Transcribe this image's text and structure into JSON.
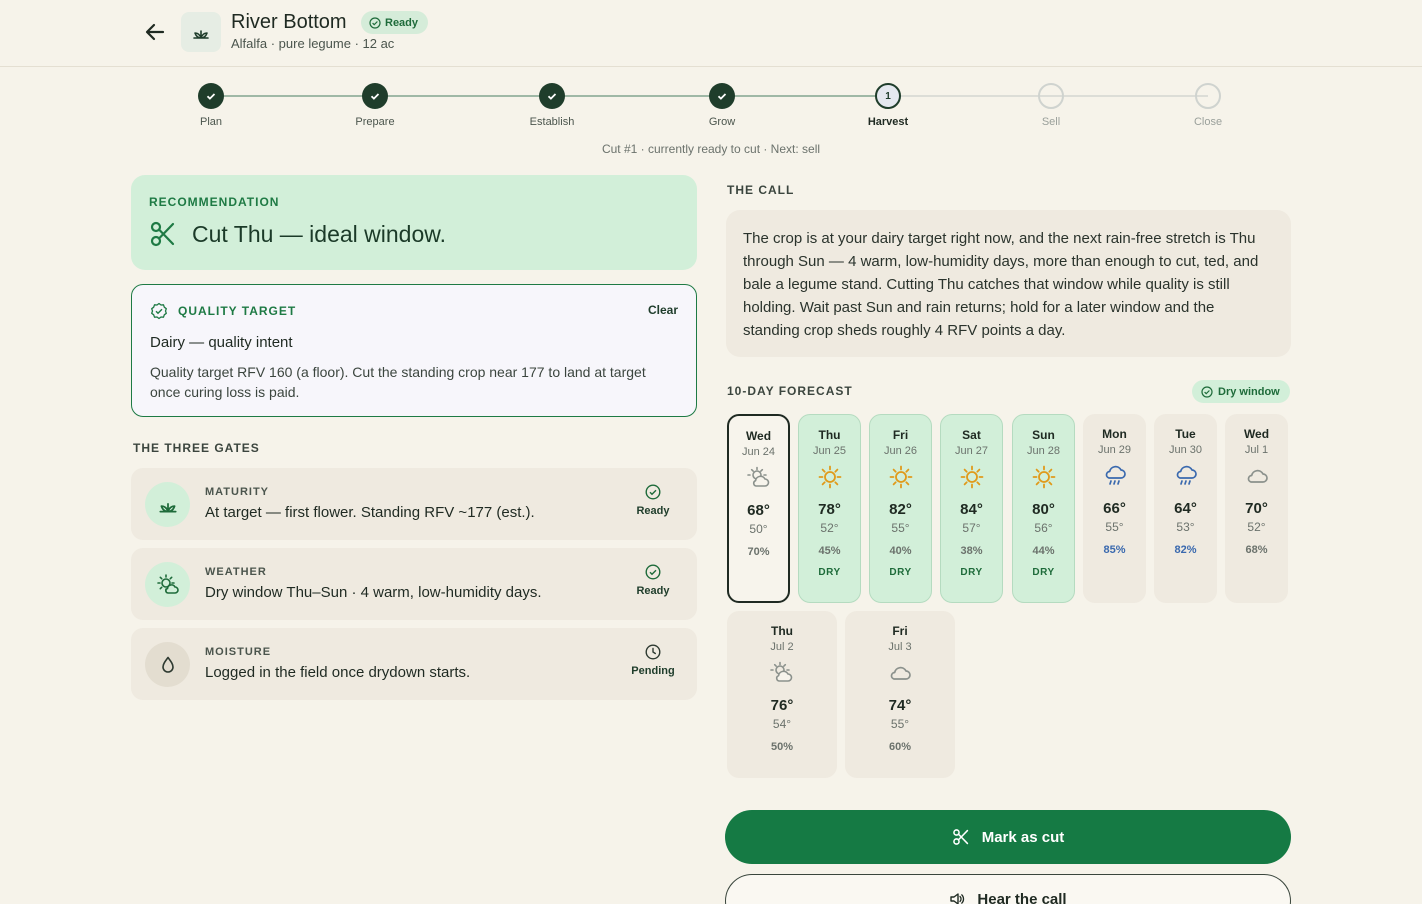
{
  "header": {
    "back_label": "Back",
    "field_name": "River Bottom",
    "status": "Ready",
    "subtitle": "Alfalfa · pure legume · 12 ac"
  },
  "stepper": {
    "steps": [
      {
        "label": "Plan",
        "state": "done"
      },
      {
        "label": "Prepare",
        "state": "done"
      },
      {
        "label": "Establish",
        "state": "done"
      },
      {
        "label": "Grow",
        "state": "done"
      },
      {
        "label": "Harvest",
        "state": "current",
        "number": "1"
      },
      {
        "label": "Sell",
        "state": "todo"
      },
      {
        "label": "Close",
        "state": "todo"
      }
    ],
    "note": "Cut #1 · currently ready to cut · Next: sell"
  },
  "recommendation": {
    "eyebrow": "RECOMMENDATION",
    "title": "Cut Thu — ideal window."
  },
  "quality_target": {
    "eyebrow": "QUALITY TARGET",
    "clear_label": "Clear",
    "title": "Dairy — quality intent",
    "body": "Quality target RFV 160 (a floor). Cut the standing crop near 177 to land at target once curing loss is paid."
  },
  "gates": {
    "heading": "THE THREE GATES",
    "items": [
      {
        "eyebrow": "MATURITY",
        "text": "At target — first flower. Standing RFV ~177 (est.).",
        "status": "Ready",
        "icon": "sprout-icon",
        "status_icon": "check-circle-icon"
      },
      {
        "eyebrow": "WEATHER",
        "text": "Dry window Thu–Sun · 4 warm, low-humidity days.",
        "status": "Ready",
        "icon": "sun-cloud-icon",
        "status_icon": "check-circle-icon"
      },
      {
        "eyebrow": "MOISTURE",
        "text": "Logged in the field once drydown starts.",
        "status": "Pending",
        "icon": "droplet-icon",
        "status_icon": "clock-icon"
      }
    ]
  },
  "the_call": {
    "heading": "THE CALL",
    "body": "The crop is at your dairy target right now, and the next rain-free stretch is Thu through Sun — 4 warm, low-humidity days, more than enough to cut, ted, and bale a legume stand. Cutting Thu catches that window while quality is still holding. Wait past Sun and rain returns; hold for a later window and the standing crop sheds roughly 4 RFV points a day."
  },
  "forecast": {
    "heading": "10-DAY FORECAST",
    "badge": "Dry window",
    "days": [
      {
        "day": "Wed",
        "date": "Jun 24",
        "icon": "partly-cloudy-icon",
        "hi": "68°",
        "lo": "50°",
        "pop": "70%",
        "tag": "",
        "style": "today"
      },
      {
        "day": "Thu",
        "date": "Jun 25",
        "icon": "sun-icon",
        "hi": "78°",
        "lo": "52°",
        "pop": "45%",
        "tag": "DRY",
        "style": "dry"
      },
      {
        "day": "Fri",
        "date": "Jun 26",
        "icon": "sun-icon",
        "hi": "82°",
        "lo": "55°",
        "pop": "40%",
        "tag": "DRY",
        "style": "dry"
      },
      {
        "day": "Sat",
        "date": "Jun 27",
        "icon": "sun-icon",
        "hi": "84°",
        "lo": "57°",
        "pop": "38%",
        "tag": "DRY",
        "style": "dry"
      },
      {
        "day": "Sun",
        "date": "Jun 28",
        "icon": "sun-icon",
        "hi": "80°",
        "lo": "56°",
        "pop": "44%",
        "tag": "DRY",
        "style": "dry"
      },
      {
        "day": "Mon",
        "date": "Jun 29",
        "icon": "rain-icon",
        "hi": "66°",
        "lo": "55°",
        "pop": "85%",
        "tag": "",
        "style": "wet"
      },
      {
        "day": "Tue",
        "date": "Jun 30",
        "icon": "rain-icon",
        "hi": "64°",
        "lo": "53°",
        "pop": "82%",
        "tag": "",
        "style": "wet"
      },
      {
        "day": "Wed",
        "date": "Jul 1",
        "icon": "cloud-icon",
        "hi": "70°",
        "lo": "52°",
        "pop": "68%",
        "tag": "",
        "style": "plain"
      },
      {
        "day": "Thu",
        "date": "Jul 2",
        "icon": "partly-cloudy-icon",
        "hi": "76°",
        "lo": "54°",
        "pop": "50%",
        "tag": "",
        "style": "plain"
      },
      {
        "day": "Fri",
        "date": "Jul 3",
        "icon": "cloud-icon",
        "hi": "74°",
        "lo": "55°",
        "pop": "60%",
        "tag": "",
        "style": "plain"
      }
    ]
  },
  "actions": {
    "primary": "Mark as cut",
    "secondary": "Hear the call"
  },
  "colors": {
    "accent": "#157a44",
    "dark": "#1f3d2b",
    "dry_bg": "#d2efd9",
    "wet_text": "#3a69ae",
    "background": "#f6f3ea"
  }
}
